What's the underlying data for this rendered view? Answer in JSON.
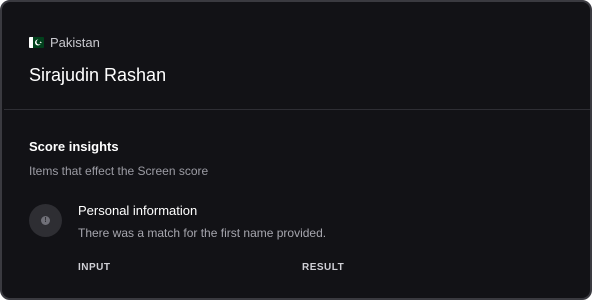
{
  "profile": {
    "country": "Pakistan",
    "name": "Sirajudin Rashan"
  },
  "score_insights": {
    "title": "Score insights",
    "subtitle": "Items that effect the Screen score",
    "items": [
      {
        "icon": "info-icon",
        "title": "Personal information",
        "description": "There was a match for the first name provided."
      }
    ]
  },
  "table": {
    "columns": [
      "INPUT",
      "RESULT"
    ]
  },
  "colors": {
    "background": "#121216",
    "text_primary": "#ffffff",
    "text_secondary": "#9c9ca4",
    "flag_green": "#01411c"
  }
}
